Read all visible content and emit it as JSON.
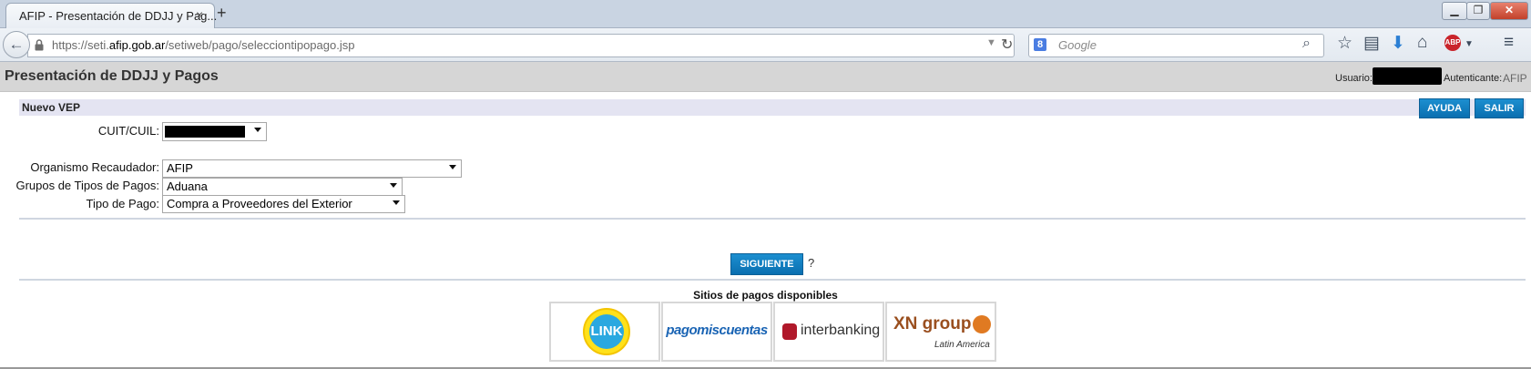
{
  "browser": {
    "tab_title": "AFIP - Presentación de DDJJ y Pag...",
    "tab_close": "×",
    "new_tab": "+",
    "url_prefix": "https://seti.",
    "url_domain": "afip.gob.ar",
    "url_path": "/setiweb/pago/selecciontipopago.jsp",
    "search_placeholder": "Google",
    "search_engine_letter": "8"
  },
  "page": {
    "title": "Presentación de DDJJ y Pagos",
    "user_label": "Usuario:",
    "auth_label": "Autenticante:",
    "auth_value": "AFIP"
  },
  "form": {
    "section_title": "Nuevo VEP",
    "help_button": "AYUDA",
    "exit_button": "SALIR",
    "cuit_label": "CUIT/CUIL:",
    "org_label": "Organismo Recaudador:",
    "org_value": "AFIP",
    "grupo_label": "Grupos de Tipos de Pagos:",
    "grupo_value": "Aduana",
    "tipo_label": "Tipo de Pago:",
    "tipo_value": "Compra a Proveedores del Exterior",
    "next_button": "SIGUIENTE",
    "help_mark": "?"
  },
  "payment_sites": {
    "title": "Sitios de pagos disponibles",
    "link": "LINK",
    "pmc": "pagomiscuentas",
    "inter": "interbanking",
    "xn": "XN group",
    "xn_sub": "Latin America"
  },
  "colors": {
    "button_blue": "#0a6fb0",
    "header_gray": "#d6d6d6",
    "section_bar": "#e4e4f2"
  }
}
